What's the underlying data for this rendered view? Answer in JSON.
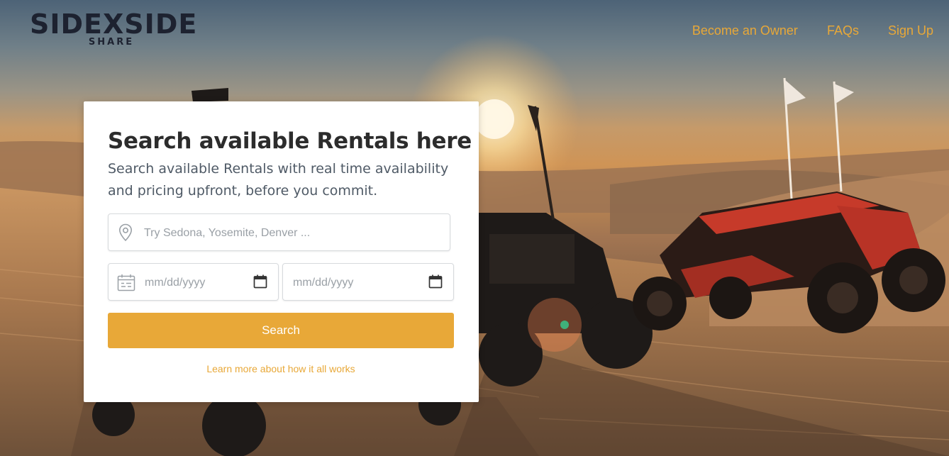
{
  "header": {
    "logo_main": "SIDEXSIDE",
    "logo_sub": "SHARE",
    "nav": [
      {
        "label": "Become an Owner"
      },
      {
        "label": "FAQs"
      },
      {
        "label": "Sign Up"
      }
    ]
  },
  "search_card": {
    "title": "Search available Rentals here",
    "subtitle": "Search available Rentals with real time availability and pricing upfront, before you commit.",
    "location_placeholder": "Try Sedona, Yosemite, Denver ...",
    "start_date_placeholder": "mm/dd/yyyy",
    "end_date_placeholder": "mm/dd/yyyy",
    "search_button_label": "Search",
    "learn_more_label": "Learn more about how it all works"
  },
  "colors": {
    "accent": "#e8a838",
    "title_text": "#2c2c2c",
    "logo": "#1d2230"
  },
  "icons": {
    "location": "map-pin-icon",
    "date_left": "calendar-icon",
    "date_picker": "calendar-picker-icon"
  }
}
